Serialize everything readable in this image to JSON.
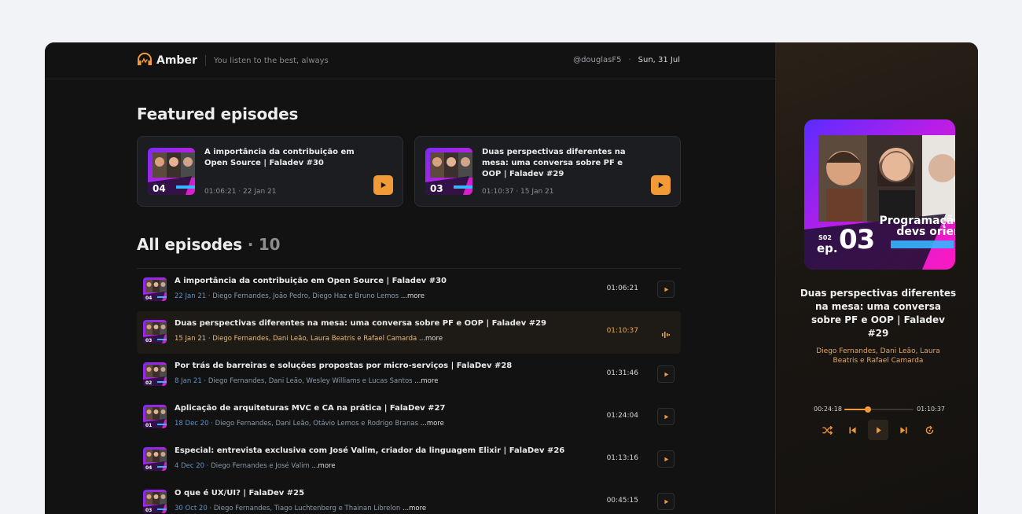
{
  "header": {
    "brand": "Amber",
    "tagline": "You listen to the best, always",
    "username": "@douglasF5",
    "date": "Sun, 31 Jul"
  },
  "featured": {
    "title": "Featured episodes",
    "cards": [
      {
        "title": "A importância da contribuição em Open Source | Faladev #30",
        "meta": "01:06:21 · 22 Jan 21",
        "ep": "04"
      },
      {
        "title": "Duas perspectivas diferentes na mesa: uma conversa sobre PF e OOP | Faladev #29",
        "meta": "01:10:37 · 15 Jan 21",
        "ep": "03"
      }
    ]
  },
  "all": {
    "title": "All episodes",
    "count": "10",
    "more_label": "...more",
    "items": [
      {
        "title": "A importância da contribuição em Open Source | Faladev #30",
        "date": "22 Jan 21",
        "authors": "Diego Fernandes, João Pedro, Diego Haz e Bruno Lemos",
        "duration": "01:06:21",
        "ep": "04",
        "active": false
      },
      {
        "title": "Duas perspectivas diferentes na mesa: uma conversa sobre PF e OOP | Faladev #29",
        "date": "15 Jan 21",
        "authors": "Diego Fernandes, Dani Leão, Laura Beatris e Rafael Camarda",
        "duration": "01:10:37",
        "ep": "03",
        "active": true
      },
      {
        "title": "Por trás de barreiras e soluções propostas por micro-serviços | FalaDev #28",
        "date": "8 Jan 21",
        "authors": "Diego Fernandes, Dani Leão, Wesley Williams e Lucas Santos",
        "duration": "01:31:46",
        "ep": "02",
        "active": false
      },
      {
        "title": "Aplicação de arquiteturas MVC e CA na prática | FalaDev #27",
        "date": "18 Dec 20",
        "authors": "Diego Fernandes, Dani Leão, Otávio Lemos e Rodrigo Branas",
        "duration": "01:24:04",
        "ep": "01",
        "active": false
      },
      {
        "title": "Especial: entrevista exclusiva com José Valim, criador da linguagem Elixir | FalaDev #26",
        "date": "4 Dec 20",
        "authors": "Diego Fernandes e José Valim",
        "duration": "01:13:16",
        "ep": "04",
        "active": false
      },
      {
        "title": "O que é UX/UI? | FalaDev #25",
        "date": "30 Oct 20",
        "authors": "Diego Fernandes, Tiago Luchtenberg e Thainan Librelon",
        "duration": "00:45:15",
        "ep": "03",
        "active": false
      }
    ]
  },
  "player": {
    "cover_season": "S02",
    "cover_ep_label": "ep.",
    "cover_ep": "03",
    "cover_text": "Programação devs orien",
    "title": "Duas perspectivas diferentes na mesa: uma conversa sobre PF e OOP | Faladev #29",
    "authors": "Diego Fernandes, Dani Leão, Laura Beatris e Rafael Camarda",
    "current_time": "00:24:18",
    "total_time": "01:10:37",
    "progress": 0.344
  },
  "colors": {
    "accent": "#f29a38",
    "bg": "#121212",
    "panel": "#1b1d20"
  },
  "icons": [
    "headphones-logo-icon",
    "play-icon",
    "waveform-icon",
    "shuffle-icon",
    "skip-previous-icon",
    "skip-next-icon",
    "repeat-icon"
  ]
}
